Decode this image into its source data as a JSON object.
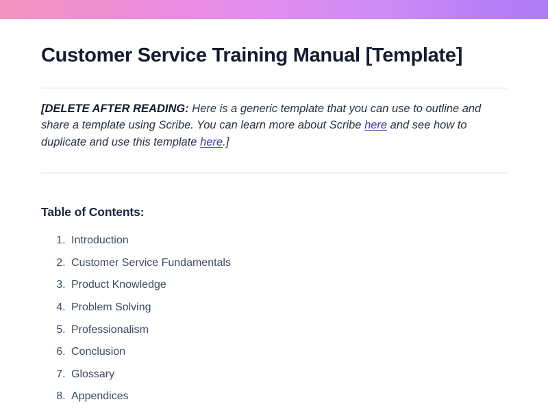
{
  "banner": {
    "gradient_from": "#f294c0",
    "gradient_mid": "#dd8cef",
    "gradient_to": "#b07cf7"
  },
  "document": {
    "title": "Customer Service Training Manual [Template]",
    "note": {
      "bold_prefix": "[DELETE AFTER READING:",
      "segment_1": " Here is a generic template that you can use to outline and share a template using Scribe. You can learn more about Scribe ",
      "link_1": "here",
      "segment_2": " and see how to duplicate and use this template ",
      "link_2": "here",
      "segment_3": ".]",
      "link_color": "#3c3ca8"
    },
    "toc": {
      "heading": "Table of Contents:",
      "items": [
        {
          "number": "1",
          "label": "Introduction"
        },
        {
          "number": "2",
          "label": "Customer Service Fundamentals"
        },
        {
          "number": "3",
          "label": "Product Knowledge"
        },
        {
          "number": "4",
          "label": "Problem Solving"
        },
        {
          "number": "5",
          "label": "Professionalism"
        },
        {
          "number": "6",
          "label": "Conclusion"
        },
        {
          "number": "7",
          "label": "Glossary"
        },
        {
          "number": "8",
          "label": "Appendices"
        }
      ]
    },
    "colors": {
      "title": "#161a2d",
      "body": "#2a2f45",
      "list": "#3d4a63",
      "divider": "#f0f1f5"
    }
  }
}
